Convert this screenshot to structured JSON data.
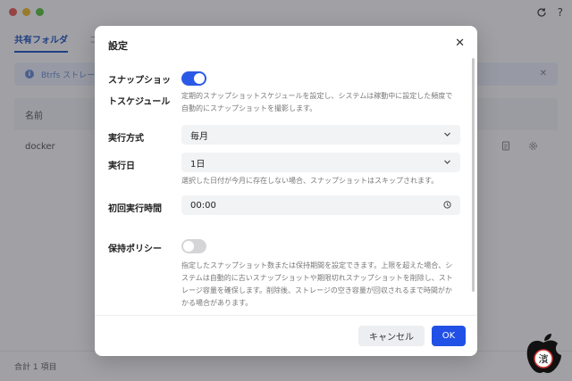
{
  "window": {
    "tabs": [
      {
        "label": "共有フォルダ",
        "active": true
      },
      {
        "label": "コ",
        "active": false
      }
    ],
    "banner_text": "Btrfs ストレージ",
    "table": {
      "header_name": "名前",
      "rows": [
        {
          "name": "docker"
        }
      ]
    },
    "footer_count": "合計 1 項目",
    "help_glyph": "?"
  },
  "modal": {
    "title": "設定",
    "snapshot": {
      "label_line1": "スナップショッ",
      "label_line2": "トスケジュール",
      "enabled": true,
      "description": "定期的スナップショットスケジュールを設定し、システムは稼動中に設定した頻度で自動的にスナップショットを撮影します。"
    },
    "method": {
      "label": "実行方式",
      "value": "毎月"
    },
    "day": {
      "label": "実行日",
      "value": "1日",
      "hint": "選択した日付が今月に存在しない場合、スナップショットはスキップされます。"
    },
    "first_time": {
      "label": "初回実行時間",
      "value": "00:00"
    },
    "retention": {
      "label": "保持ポリシー",
      "enabled": false,
      "description": "指定したスナップショット数または保持期間を設定できます。上限を超えた場合、システムは自動的に古いスナップショットや期限切れスナップショットを削除し、ストレージ容量を確保します。削除後、ストレージの空き容量が回収されるまで時間がかかる場合があります。"
    },
    "cancel_label": "キャンセル",
    "ok_label": "OK"
  },
  "watermark": {
    "text": "濱",
    "label": "濱"
  },
  "colors": {
    "accent": "#2050e6",
    "toggle_on": "#2a59e8",
    "toggle_off": "#d5d5d8",
    "tab_active": "#2257c8"
  }
}
